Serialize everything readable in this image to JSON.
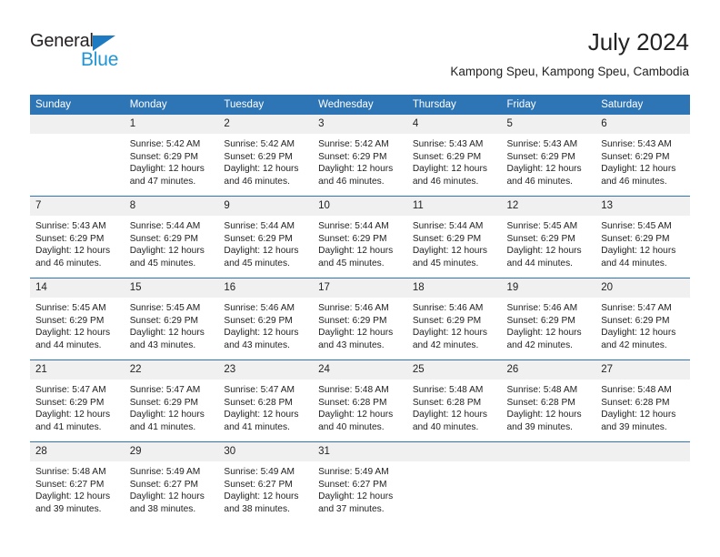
{
  "brand": {
    "name_top": "General",
    "name_bottom": "Blue",
    "accent_color": "#2196d6",
    "triangle_color": "#1f7bc1"
  },
  "header": {
    "title": "July 2024",
    "subtitle": "Kampong Speu, Kampong Speu, Cambodia"
  },
  "theme": {
    "header_bg": "#2e75b6",
    "daynum_bg": "#f0f0f0",
    "text_color": "#222222",
    "grid_line": "#2e75b6"
  },
  "weekday_headers": [
    "Sunday",
    "Monday",
    "Tuesday",
    "Wednesday",
    "Thursday",
    "Friday",
    "Saturday"
  ],
  "weeks": [
    [
      {
        "day": "",
        "empty": true,
        "sunrise": "",
        "sunset": "",
        "daylight_line1": "",
        "daylight_line2": ""
      },
      {
        "day": "1",
        "sunrise": "Sunrise: 5:42 AM",
        "sunset": "Sunset: 6:29 PM",
        "daylight_line1": "Daylight: 12 hours",
        "daylight_line2": "and 47 minutes."
      },
      {
        "day": "2",
        "sunrise": "Sunrise: 5:42 AM",
        "sunset": "Sunset: 6:29 PM",
        "daylight_line1": "Daylight: 12 hours",
        "daylight_line2": "and 46 minutes."
      },
      {
        "day": "3",
        "sunrise": "Sunrise: 5:42 AM",
        "sunset": "Sunset: 6:29 PM",
        "daylight_line1": "Daylight: 12 hours",
        "daylight_line2": "and 46 minutes."
      },
      {
        "day": "4",
        "sunrise": "Sunrise: 5:43 AM",
        "sunset": "Sunset: 6:29 PM",
        "daylight_line1": "Daylight: 12 hours",
        "daylight_line2": "and 46 minutes."
      },
      {
        "day": "5",
        "sunrise": "Sunrise: 5:43 AM",
        "sunset": "Sunset: 6:29 PM",
        "daylight_line1": "Daylight: 12 hours",
        "daylight_line2": "and 46 minutes."
      },
      {
        "day": "6",
        "sunrise": "Sunrise: 5:43 AM",
        "sunset": "Sunset: 6:29 PM",
        "daylight_line1": "Daylight: 12 hours",
        "daylight_line2": "and 46 minutes."
      }
    ],
    [
      {
        "day": "7",
        "sunrise": "Sunrise: 5:43 AM",
        "sunset": "Sunset: 6:29 PM",
        "daylight_line1": "Daylight: 12 hours",
        "daylight_line2": "and 46 minutes."
      },
      {
        "day": "8",
        "sunrise": "Sunrise: 5:44 AM",
        "sunset": "Sunset: 6:29 PM",
        "daylight_line1": "Daylight: 12 hours",
        "daylight_line2": "and 45 minutes."
      },
      {
        "day": "9",
        "sunrise": "Sunrise: 5:44 AM",
        "sunset": "Sunset: 6:29 PM",
        "daylight_line1": "Daylight: 12 hours",
        "daylight_line2": "and 45 minutes."
      },
      {
        "day": "10",
        "sunrise": "Sunrise: 5:44 AM",
        "sunset": "Sunset: 6:29 PM",
        "daylight_line1": "Daylight: 12 hours",
        "daylight_line2": "and 45 minutes."
      },
      {
        "day": "11",
        "sunrise": "Sunrise: 5:44 AM",
        "sunset": "Sunset: 6:29 PM",
        "daylight_line1": "Daylight: 12 hours",
        "daylight_line2": "and 45 minutes."
      },
      {
        "day": "12",
        "sunrise": "Sunrise: 5:45 AM",
        "sunset": "Sunset: 6:29 PM",
        "daylight_line1": "Daylight: 12 hours",
        "daylight_line2": "and 44 minutes."
      },
      {
        "day": "13",
        "sunrise": "Sunrise: 5:45 AM",
        "sunset": "Sunset: 6:29 PM",
        "daylight_line1": "Daylight: 12 hours",
        "daylight_line2": "and 44 minutes."
      }
    ],
    [
      {
        "day": "14",
        "sunrise": "Sunrise: 5:45 AM",
        "sunset": "Sunset: 6:29 PM",
        "daylight_line1": "Daylight: 12 hours",
        "daylight_line2": "and 44 minutes."
      },
      {
        "day": "15",
        "sunrise": "Sunrise: 5:45 AM",
        "sunset": "Sunset: 6:29 PM",
        "daylight_line1": "Daylight: 12 hours",
        "daylight_line2": "and 43 minutes."
      },
      {
        "day": "16",
        "sunrise": "Sunrise: 5:46 AM",
        "sunset": "Sunset: 6:29 PM",
        "daylight_line1": "Daylight: 12 hours",
        "daylight_line2": "and 43 minutes."
      },
      {
        "day": "17",
        "sunrise": "Sunrise: 5:46 AM",
        "sunset": "Sunset: 6:29 PM",
        "daylight_line1": "Daylight: 12 hours",
        "daylight_line2": "and 43 minutes."
      },
      {
        "day": "18",
        "sunrise": "Sunrise: 5:46 AM",
        "sunset": "Sunset: 6:29 PM",
        "daylight_line1": "Daylight: 12 hours",
        "daylight_line2": "and 42 minutes."
      },
      {
        "day": "19",
        "sunrise": "Sunrise: 5:46 AM",
        "sunset": "Sunset: 6:29 PM",
        "daylight_line1": "Daylight: 12 hours",
        "daylight_line2": "and 42 minutes."
      },
      {
        "day": "20",
        "sunrise": "Sunrise: 5:47 AM",
        "sunset": "Sunset: 6:29 PM",
        "daylight_line1": "Daylight: 12 hours",
        "daylight_line2": "and 42 minutes."
      }
    ],
    [
      {
        "day": "21",
        "sunrise": "Sunrise: 5:47 AM",
        "sunset": "Sunset: 6:29 PM",
        "daylight_line1": "Daylight: 12 hours",
        "daylight_line2": "and 41 minutes."
      },
      {
        "day": "22",
        "sunrise": "Sunrise: 5:47 AM",
        "sunset": "Sunset: 6:29 PM",
        "daylight_line1": "Daylight: 12 hours",
        "daylight_line2": "and 41 minutes."
      },
      {
        "day": "23",
        "sunrise": "Sunrise: 5:47 AM",
        "sunset": "Sunset: 6:28 PM",
        "daylight_line1": "Daylight: 12 hours",
        "daylight_line2": "and 41 minutes."
      },
      {
        "day": "24",
        "sunrise": "Sunrise: 5:48 AM",
        "sunset": "Sunset: 6:28 PM",
        "daylight_line1": "Daylight: 12 hours",
        "daylight_line2": "and 40 minutes."
      },
      {
        "day": "25",
        "sunrise": "Sunrise: 5:48 AM",
        "sunset": "Sunset: 6:28 PM",
        "daylight_line1": "Daylight: 12 hours",
        "daylight_line2": "and 40 minutes."
      },
      {
        "day": "26",
        "sunrise": "Sunrise: 5:48 AM",
        "sunset": "Sunset: 6:28 PM",
        "daylight_line1": "Daylight: 12 hours",
        "daylight_line2": "and 39 minutes."
      },
      {
        "day": "27",
        "sunrise": "Sunrise: 5:48 AM",
        "sunset": "Sunset: 6:28 PM",
        "daylight_line1": "Daylight: 12 hours",
        "daylight_line2": "and 39 minutes."
      }
    ],
    [
      {
        "day": "28",
        "sunrise": "Sunrise: 5:48 AM",
        "sunset": "Sunset: 6:27 PM",
        "daylight_line1": "Daylight: 12 hours",
        "daylight_line2": "and 39 minutes."
      },
      {
        "day": "29",
        "sunrise": "Sunrise: 5:49 AM",
        "sunset": "Sunset: 6:27 PM",
        "daylight_line1": "Daylight: 12 hours",
        "daylight_line2": "and 38 minutes."
      },
      {
        "day": "30",
        "sunrise": "Sunrise: 5:49 AM",
        "sunset": "Sunset: 6:27 PM",
        "daylight_line1": "Daylight: 12 hours",
        "daylight_line2": "and 38 minutes."
      },
      {
        "day": "31",
        "sunrise": "Sunrise: 5:49 AM",
        "sunset": "Sunset: 6:27 PM",
        "daylight_line1": "Daylight: 12 hours",
        "daylight_line2": "and 37 minutes."
      },
      {
        "day": "",
        "empty": true,
        "sunrise": "",
        "sunset": "",
        "daylight_line1": "",
        "daylight_line2": ""
      },
      {
        "day": "",
        "empty": true,
        "sunrise": "",
        "sunset": "",
        "daylight_line1": "",
        "daylight_line2": ""
      },
      {
        "day": "",
        "empty": true,
        "sunrise": "",
        "sunset": "",
        "daylight_line1": "",
        "daylight_line2": ""
      }
    ]
  ]
}
